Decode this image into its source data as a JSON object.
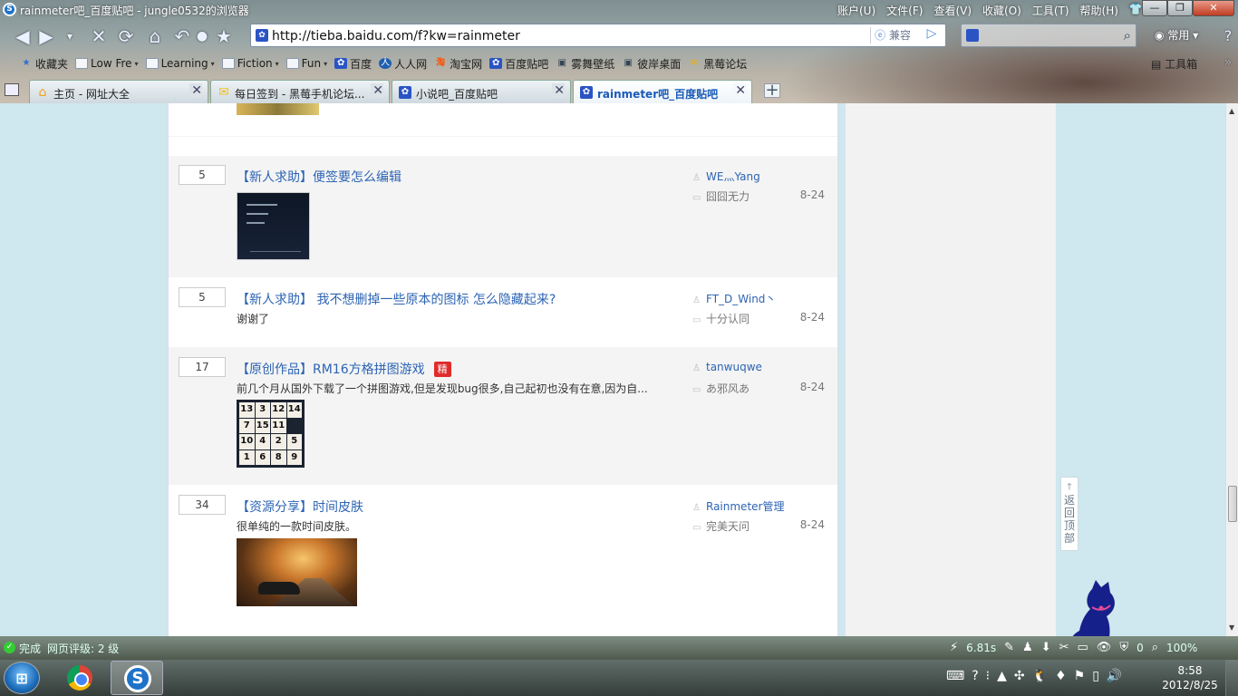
{
  "window": {
    "title": "rainmeter吧_百度贴吧 - jungle0532的浏览器",
    "menu": [
      "账户(U)",
      "文件(F)",
      "查看(V)",
      "收藏(O)",
      "工具(T)",
      "帮助(H)"
    ],
    "app_icon": "S"
  },
  "navbar": {
    "url": "http://tieba.baidu.com/f?kw=rainmeter",
    "compat_label": "兼容",
    "search_placeholder": "",
    "common_label": "常用"
  },
  "bookmarks": [
    {
      "label": "收藏夹",
      "icon": "star-icon"
    },
    {
      "label": "Low Fre",
      "icon": "folder-icon",
      "dropdown": true
    },
    {
      "label": "Learning",
      "icon": "folder-icon",
      "dropdown": true
    },
    {
      "label": "Fiction",
      "icon": "folder-icon",
      "dropdown": true
    },
    {
      "label": "Fun",
      "icon": "folder-icon",
      "dropdown": true
    },
    {
      "label": "百度",
      "icon": "baidu-paw-icon"
    },
    {
      "label": "人人网",
      "icon": "renren-icon"
    },
    {
      "label": "淘宝网",
      "icon": "taobao-icon"
    },
    {
      "label": "百度贴吧",
      "icon": "baidu-paw-icon"
    },
    {
      "label": "雾舞壁纸",
      "icon": "monitor-icon"
    },
    {
      "label": "彼岸桌面",
      "icon": "monitor-icon"
    },
    {
      "label": "黑莓论坛",
      "icon": "envelope-icon"
    }
  ],
  "toolbox_label": "工具箱",
  "tabs": [
    {
      "label": "主页 - 网址大全",
      "icon": "home-icon",
      "color": "#f0a020",
      "active": false
    },
    {
      "label": "每日签到 - 黑莓手机论坛...",
      "icon": "envelope-icon",
      "color": "#f0c020",
      "active": false
    },
    {
      "label": "小说吧_百度贴吧",
      "icon": "baidu-paw-icon",
      "color": "#2a54c4",
      "active": false
    },
    {
      "label": "rainmeter吧_百度贴吧",
      "icon": "baidu-paw-icon",
      "color": "#2a54c4",
      "active": true
    }
  ],
  "threads": [
    {
      "replies": "5",
      "title": "【新人求助】便签要怎么编辑",
      "excerpt": "",
      "author": "WE灬Yang",
      "last_reply": "囧囧无力",
      "date": "8-24",
      "badge": "",
      "thumb": "dark-notes"
    },
    {
      "replies": "5",
      "title": "【新人求助】 我不想删掉一些原本的图标  怎么隐藏起来?",
      "excerpt": "谢谢了",
      "author": "FT_D_Wind丶",
      "last_reply": "十分认同",
      "date": "8-24",
      "badge": "",
      "thumb": ""
    },
    {
      "replies": "17",
      "title": "【原创作品】RM16方格拼图游戏",
      "excerpt": "前几个月从国外下载了一个拼图游戏,但是发现bug很多,自己起初也没有在意,因为自...",
      "author": "tanwuqwe",
      "last_reply": "あ邪风あ",
      "date": "8-24",
      "badge": "精",
      "thumb": "puzzle",
      "puzzle_tiles": [
        "13",
        "3",
        "12",
        "14",
        "7",
        "15",
        "11",
        "",
        "10",
        "4",
        "2",
        "5",
        "1",
        "6",
        "8",
        "9"
      ]
    },
    {
      "replies": "34",
      "title": "【资源分享】时间皮肤",
      "excerpt": "很单纯的一款时间皮肤。",
      "author": "Rainmeter管理",
      "last_reply": "完美天问",
      "date": "8-24",
      "badge": "",
      "thumb": "car-road"
    }
  ],
  "back_to_top": [
    "返",
    "回",
    "顶",
    "部"
  ],
  "statusbar": {
    "status": "完成",
    "rating": "网页评级: 2 级",
    "speed": "6.81s",
    "count": "0",
    "zoom": "100%"
  },
  "taskbar": {
    "time": "8:58",
    "date": "2012/8/25"
  },
  "colors": {
    "link": "#2d64b3",
    "badge": "#e02b2b",
    "page_bg": "#cfe7ef"
  }
}
